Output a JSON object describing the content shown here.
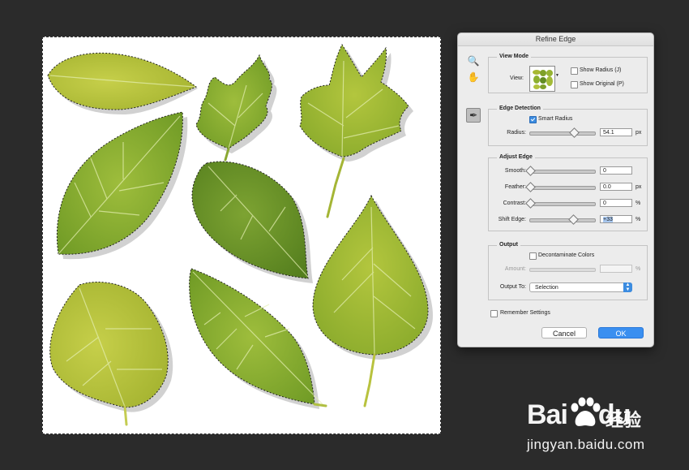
{
  "dialog": {
    "title": "Refine Edge",
    "view_mode": {
      "legend": "View Mode",
      "view_label": "View:",
      "show_radius": {
        "label": "Show Radius (J)",
        "checked": false
      },
      "show_original": {
        "label": "Show Original (P)",
        "checked": false
      }
    },
    "edge_detection": {
      "legend": "Edge Detection",
      "smart_radius": {
        "label": "Smart Radius",
        "checked": true
      },
      "radius": {
        "label": "Radius:",
        "value": "54.1",
        "unit": "px",
        "level": 0.67
      }
    },
    "adjust_edge": {
      "legend": "Adjust Edge",
      "smooth": {
        "label": "Smooth:",
        "value": "0",
        "unit": "",
        "level": 0.0
      },
      "feather": {
        "label": "Feather:",
        "value": "0.0",
        "unit": "px",
        "level": 0.0
      },
      "contrast": {
        "label": "Contrast:",
        "value": "0",
        "unit": "%",
        "level": 0.0
      },
      "shift_edge": {
        "label": "Shift Edge:",
        "value": "+33",
        "unit": "%",
        "level": 0.66
      }
    },
    "output": {
      "legend": "Output",
      "decontaminate": {
        "label": "Decontaminate Colors",
        "checked": false
      },
      "amount": {
        "label": "Amount:",
        "value": "",
        "unit": "%"
      },
      "output_to": {
        "label": "Output To:",
        "value": "Selection"
      }
    },
    "remember": {
      "label": "Remember Settings",
      "checked": false
    },
    "cancel_label": "Cancel",
    "ok_label": "OK"
  },
  "tools": [
    "zoom-icon",
    "hand-icon",
    "refine-radius-brush-icon"
  ],
  "watermark": {
    "logo": "Bai",
    "logo_suffix": "du",
    "service": "经验",
    "url": "jingyan.baidu.com"
  },
  "colors": {
    "background": "#2b2b2b",
    "accent": "#3a8ff0",
    "leaf_light": "#b7c63a",
    "leaf_mid": "#8fae2e",
    "leaf_dark": "#6a8f22"
  }
}
